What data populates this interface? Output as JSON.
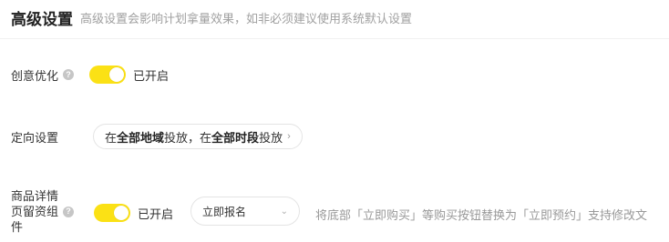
{
  "header": {
    "title": "高级设置",
    "subtitle": "高级设置会影响计划拿量效果，如非必须建议使用系统默认设置"
  },
  "creative_optimization": {
    "label": "创意优化",
    "help_glyph": "?",
    "toggle_on": true,
    "status_text": "已开启"
  },
  "targeting": {
    "label": "定向设置",
    "value_parts": [
      "在",
      "全部地域",
      "投放，在",
      "全部时段",
      "投放"
    ],
    "chevron_icon": "chevron-right-icon"
  },
  "product_detail": {
    "label_lines": [
      "商品详情",
      "页留资组",
      "件"
    ],
    "help_glyph": "?",
    "toggle_on": true,
    "status_text": "已开启",
    "select_value": "立即报名",
    "chevron_icon": "chevron-down-icon",
    "note": "将底部「立即购买」等购买按钮替换为「立即预约」支持修改文"
  },
  "colors": {
    "toggle_on": "#fbe115",
    "muted_text": "#999999"
  }
}
